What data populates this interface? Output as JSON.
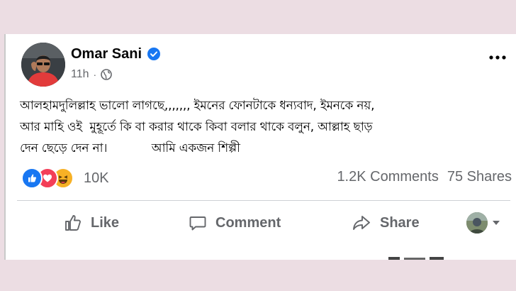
{
  "post": {
    "author": "Omar Sani",
    "time": "11h",
    "dot": "·",
    "text": "আলহামদুলিল্লাহ ভালো লাগছে,,,,,,, ইমনের ফোনটাকে ধন্যবাদ, ইমনকে নয়,\nআর মাহি ওই  মুহূর্তে কি বা করার থাকে কিবা বলার থাকে বলুন, আল্লাহ ছাড়\nদেন ছেড়ে দেন না।            আমি একজন শিল্পী"
  },
  "engagement": {
    "reaction_count": "10K",
    "comments": "1.2K Comments",
    "shares": "75 Shares",
    "reaction_icons": [
      "like-icon",
      "love-icon",
      "haha-icon"
    ]
  },
  "actions": {
    "like": "Like",
    "comment": "Comment",
    "share": "Share"
  },
  "colors": {
    "background": "#ecdde3",
    "verified": "#1877f2",
    "like": "#1877f2",
    "love": "#f33e58",
    "haha": "#f7b125",
    "muted_text": "#65676b"
  }
}
